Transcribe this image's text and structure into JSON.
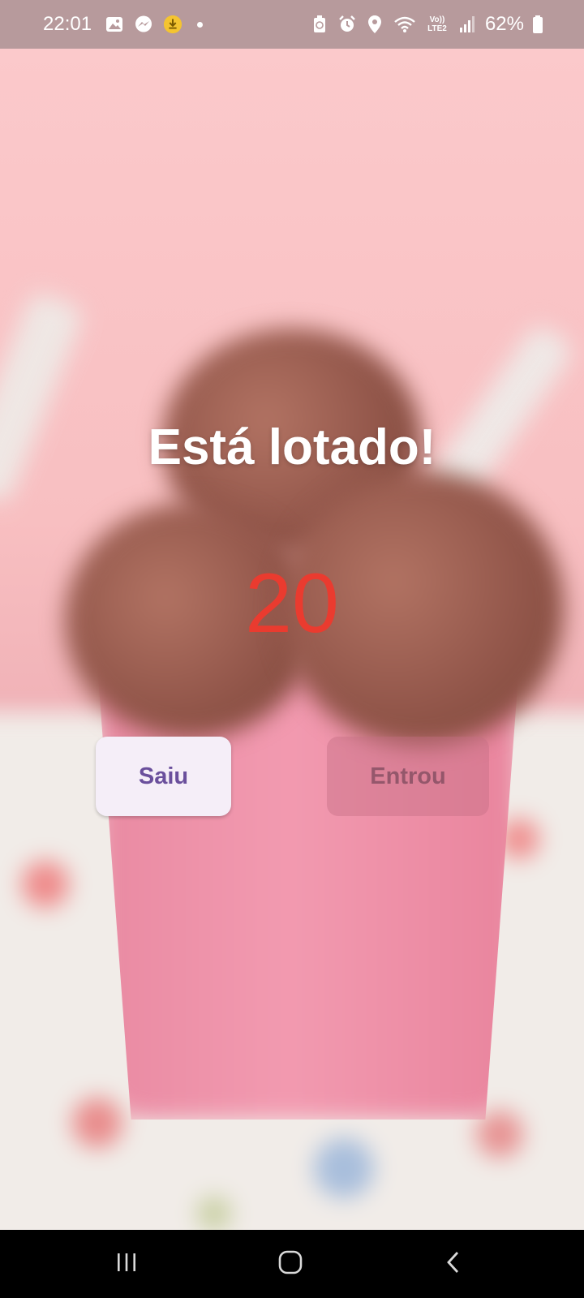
{
  "status_bar": {
    "time": "22:01",
    "notification_icons": [
      "gallery-icon",
      "messenger-icon",
      "download-icon"
    ],
    "system_icons": [
      "battery-saver-icon",
      "alarm-icon",
      "location-icon",
      "wifi-icon",
      "volte-icon",
      "signal-icon"
    ],
    "volte_top": "Vo))",
    "volte_bottom": "LTE2",
    "battery_percent": "62%"
  },
  "main": {
    "headline": "Está lotado!",
    "count": "20",
    "count_color": "#ea3b2f",
    "buttons": {
      "saiu_label": "Saiu",
      "entrou_label": "Entrou",
      "entrou_enabled": false
    }
  },
  "nav_bar": {
    "buttons": [
      "recents-icon",
      "home-icon",
      "back-icon"
    ]
  }
}
